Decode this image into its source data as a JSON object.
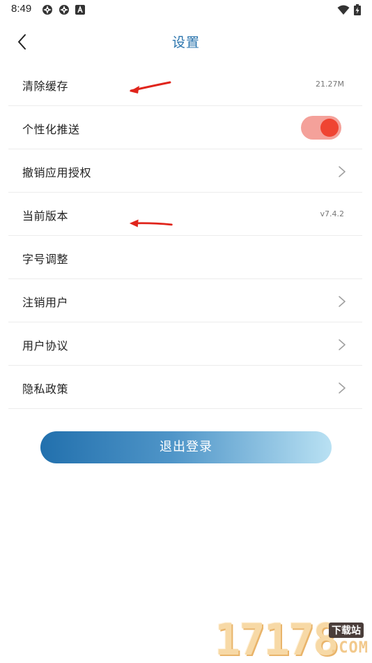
{
  "status_bar": {
    "time": "8:49",
    "icons": [
      "app-badge-icon",
      "app-badge-icon",
      "font-icon",
      "wifi-icon",
      "battery-charging-icon"
    ]
  },
  "header": {
    "title": "设置",
    "back_icon": "chevron-left-icon"
  },
  "settings": {
    "items": [
      {
        "label": "清除缓存",
        "value": "21.27M",
        "control": "value"
      },
      {
        "label": "个性化推送",
        "control": "toggle",
        "toggle_on": true
      },
      {
        "label": "撤销应用授权",
        "control": "chevron"
      },
      {
        "label": "当前版本",
        "value": "v7.4.2",
        "control": "value"
      },
      {
        "label": "字号调整",
        "control": "none"
      },
      {
        "label": "注销用户",
        "control": "chevron"
      },
      {
        "label": "用户协议",
        "control": "chevron"
      },
      {
        "label": "隐私政策",
        "control": "chevron"
      }
    ]
  },
  "logout": {
    "label": "退出登录"
  },
  "watermark": {
    "digits": "17178",
    "badge": "下载站",
    "domain": ".COM"
  },
  "colors": {
    "title": "#2a74ad",
    "toggle_track": "#f4a19a",
    "toggle_knob": "#ef4432",
    "button_gradient_start": "#2270ad",
    "button_gradient_end": "#b9e1f3",
    "annotation_arrow": "#e0241b"
  }
}
